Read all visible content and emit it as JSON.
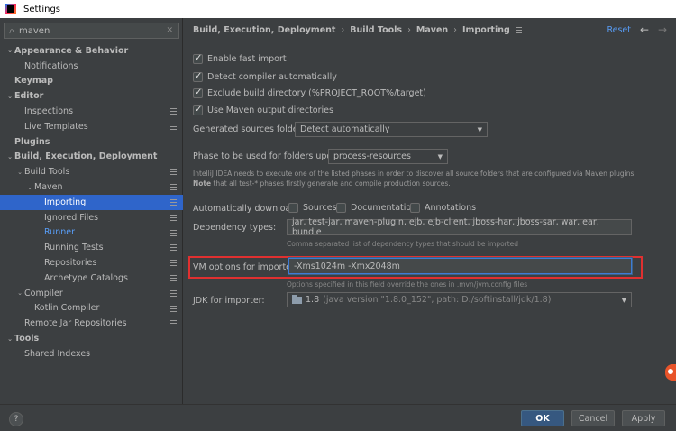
{
  "window": {
    "title": "Settings"
  },
  "search": {
    "value": "maven",
    "placeholder": ""
  },
  "sidebar": {
    "items": [
      {
        "label": "Appearance & Behavior",
        "level": 0,
        "expanded": true,
        "bold": true
      },
      {
        "label": "Notifications",
        "level": 1
      },
      {
        "label": "Keymap",
        "level": 0,
        "bold": true
      },
      {
        "label": "Editor",
        "level": 0,
        "expanded": true,
        "bold": true
      },
      {
        "label": "Inspections",
        "level": 1,
        "page_icon": true
      },
      {
        "label": "Live Templates",
        "level": 1,
        "page_icon": true
      },
      {
        "label": "Plugins",
        "level": 0,
        "bold": true
      },
      {
        "label": "Build, Execution, Deployment",
        "level": 0,
        "expanded": true,
        "bold": true
      },
      {
        "label": "Build Tools",
        "level": 1,
        "expanded": true,
        "page_icon": true
      },
      {
        "label": "Maven",
        "level": 2,
        "expanded": true,
        "page_icon": true
      },
      {
        "label": "Importing",
        "level": 3,
        "selected": true,
        "page_icon": true
      },
      {
        "label": "Ignored Files",
        "level": 3,
        "page_icon": true
      },
      {
        "label": "Runner",
        "level": 3,
        "page_icon": true,
        "link": true
      },
      {
        "label": "Running Tests",
        "level": 3,
        "page_icon": true
      },
      {
        "label": "Repositories",
        "level": 3,
        "page_icon": true
      },
      {
        "label": "Archetype Catalogs",
        "level": 3,
        "page_icon": true
      },
      {
        "label": "Compiler",
        "level": 1,
        "expanded": true,
        "page_icon": true
      },
      {
        "label": "Kotlin Compiler",
        "level": 2,
        "page_icon": true
      },
      {
        "label": "Remote Jar Repositories",
        "level": 1,
        "page_icon": true
      },
      {
        "label": "Tools",
        "level": 0,
        "expanded": true,
        "bold": true
      },
      {
        "label": "Shared Indexes",
        "level": 1
      }
    ]
  },
  "breadcrumb": [
    "Build, Execution, Deployment",
    "Build Tools",
    "Maven",
    "Importing"
  ],
  "header": {
    "reset_label": "Reset"
  },
  "settings": {
    "enable_fast_import": {
      "label": "Enable fast import",
      "checked": true
    },
    "detect_compiler": {
      "label": "Detect compiler automatically",
      "checked": true
    },
    "exclude_build_dir": {
      "label": "Exclude build directory (%PROJECT_ROOT%/target)",
      "checked": true
    },
    "use_output_dirs": {
      "label": "Use Maven output directories",
      "checked": true
    },
    "generated_sources": {
      "label": "Generated sources folders:",
      "value": "Detect automatically"
    },
    "phase": {
      "label": "Phase to be used for folders update:",
      "value": "process-resources"
    },
    "phase_note_1": "IntelliJ IDEA needs to execute one of the listed phases in order to discover all source folders that are configured via Maven plugins.",
    "phase_note_bold": "Note",
    "phase_note_2": " that all test-* phases firstly generate and compile production sources.",
    "auto_download": {
      "label": "Automatically download:",
      "sources": "Sources",
      "documentation": "Documentation",
      "annotations": "Annotations"
    },
    "dependency_types": {
      "label": "Dependency types:",
      "value": "jar, test-jar, maven-plugin, ejb, ejb-client, jboss-har, jboss-sar, war, ear, bundle",
      "hint": "Comma separated list of dependency types that should be imported"
    },
    "vm_options": {
      "label": "VM options for importer:",
      "value": "-Xms1024m -Xmx2048m",
      "hint": "Options specified in this field override the ones in .mvn/jvm.config files"
    },
    "jdk": {
      "label": "JDK for importer:",
      "value": "1.8",
      "detail": "(java version \"1.8.0_152\", path: D:/softinstall/jdk/1.8)"
    }
  },
  "footer": {
    "help": "?",
    "ok": "OK",
    "cancel": "Cancel",
    "apply": "Apply"
  }
}
